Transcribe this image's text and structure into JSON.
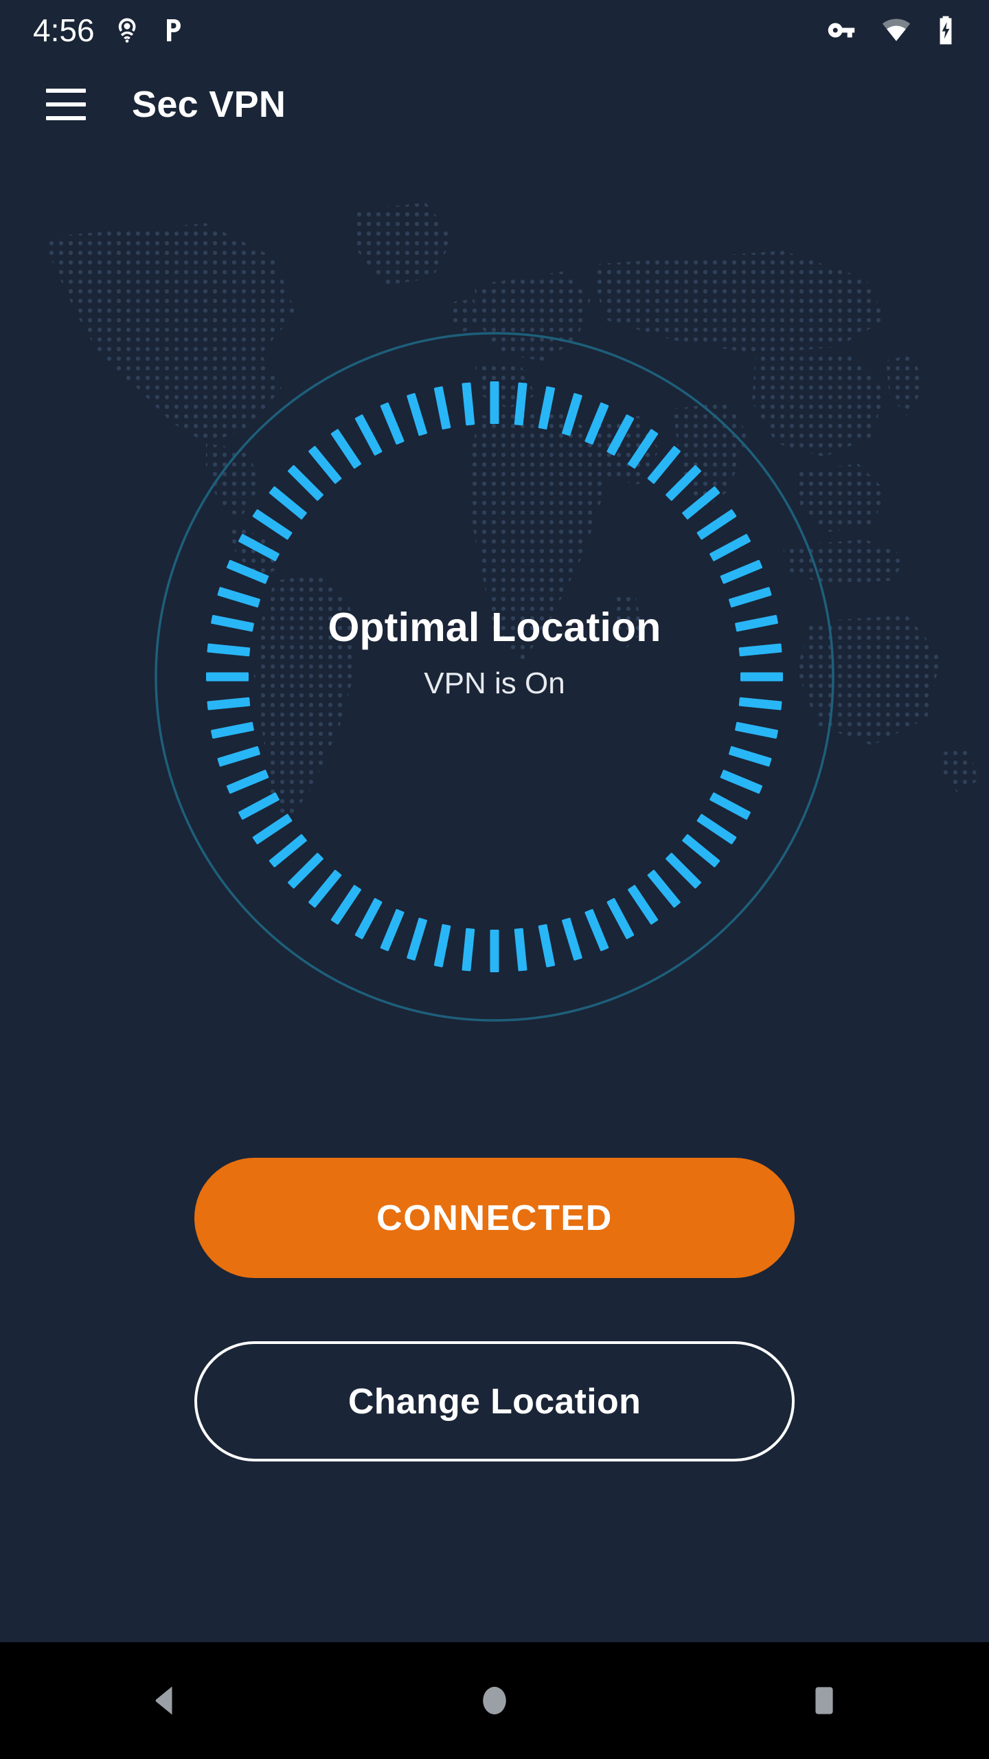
{
  "status_bar": {
    "clock": "4:56",
    "left_icons": [
      {
        "name": "hotspot-icon",
        "label": "Hotspot"
      },
      {
        "name": "pandora-notification-icon",
        "label": "P"
      }
    ],
    "right_icons": [
      {
        "name": "vpn-key-icon",
        "label": "VPN"
      },
      {
        "name": "wifi-icon",
        "label": "Wi-Fi"
      },
      {
        "name": "battery-charging-icon",
        "label": "Charging"
      }
    ]
  },
  "app_bar": {
    "menu_icon": "hamburger-menu-icon",
    "title": "Sec VPN"
  },
  "dial": {
    "location_name": "Optimal Location",
    "status_text": "VPN is On",
    "tick_count": 64,
    "tick_color": "#29B6F6",
    "ring_color": "#1E5F7A",
    "state": "connected"
  },
  "buttons": {
    "primary_label": "CONNECTED",
    "primary_color": "#E8700F",
    "primary_text_color": "#FFFFFF",
    "secondary_label": "Change Location",
    "secondary_border_color": "#FFFFFF",
    "secondary_text_color": "#FFFFFF"
  },
  "nav_bar": {
    "back_label": "Back",
    "home_label": "Home",
    "recents_label": "Recents",
    "icon_color": "#9AA0A6"
  },
  "theme": {
    "background": "#1A2537",
    "accent": "#29B6F6",
    "orange": "#E8700F",
    "map_dot": "#2C3B52",
    "nav_background": "#000000"
  }
}
